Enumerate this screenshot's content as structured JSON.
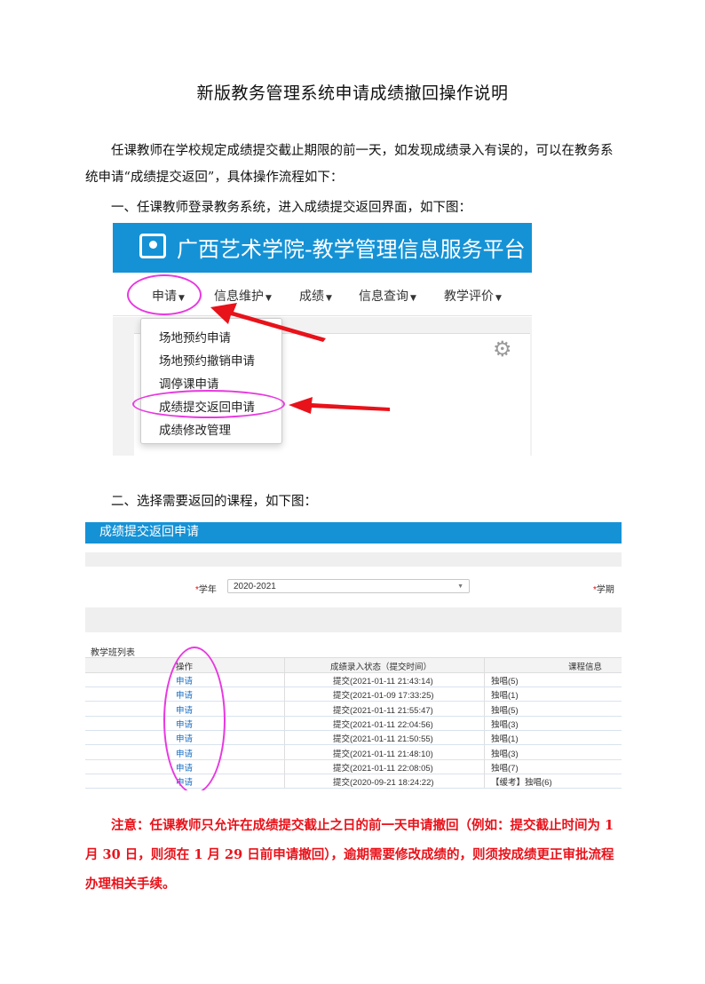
{
  "doc": {
    "title": "新版教务管理系统申请成绩撤回操作说明",
    "para1": "任课教师在学校规定成绩提交截止期限的前一天，如发现成绩录入有误的，可以在教务系统申请“成绩提交返回”，具体操作流程如下：",
    "step1": "一、任课教师登录教务系统，进入成绩提交返回界面，如下图：",
    "step2": "二、选择需要返回的课程，如下图：",
    "note": "注意：任课教师只允许在成绩提交截止之日的前一天申请撤回（例如：提交截止时间为 1 月 30 日，则须在 1 月 29 日前申请撤回），逾期需要修改成绩的，则须按成绩更正审批流程办理相关手续。"
  },
  "shot1": {
    "banner_title": "广西艺术学院-教学管理信息服务平台",
    "nav": [
      "申请",
      "信息维护",
      "成绩",
      "信息查询",
      "教学评价"
    ],
    "dropdown": [
      "场地预约申请",
      "场地预约撤销申请",
      "调停课申请",
      "成绩提交返回申请",
      "成绩修改管理"
    ],
    "colors": {
      "banner": "#1592d6",
      "highlight": "#e838e0",
      "arrow": "#e8121a"
    },
    "icons": [
      "logo-icon",
      "gear-icon",
      "arrow-icon"
    ]
  },
  "shot2": {
    "header_title": "成绩提交返回申请",
    "year_label": "学年",
    "year_value": "2020-2021",
    "term_label": "学期",
    "table_title": "教学班列表",
    "columns": [
      "操作",
      "成绩录入状态（提交时间）",
      "课程信息"
    ],
    "rows": [
      {
        "action": "申请",
        "status": "提交(2021-01-11 21:43:14)",
        "course": "独唱(5)"
      },
      {
        "action": "申请",
        "status": "提交(2021-01-09 17:33:25)",
        "course": "独唱(1)"
      },
      {
        "action": "申请",
        "status": "提交(2021-01-11 21:55:47)",
        "course": "独唱(5)"
      },
      {
        "action": "申请",
        "status": "提交(2021-01-11 22:04:56)",
        "course": "独唱(3)"
      },
      {
        "action": "申请",
        "status": "提交(2021-01-11 21:50:55)",
        "course": "独唱(1)"
      },
      {
        "action": "申请",
        "status": "提交(2021-01-11 21:48:10)",
        "course": "独唱(3)"
      },
      {
        "action": "申请",
        "status": "提交(2021-01-11 22:08:05)",
        "course": "独唱(7)"
      },
      {
        "action": "申请",
        "status": "提交(2020-09-21 18:24:22)",
        "course": "【缓考】独唱(6)"
      }
    ]
  }
}
